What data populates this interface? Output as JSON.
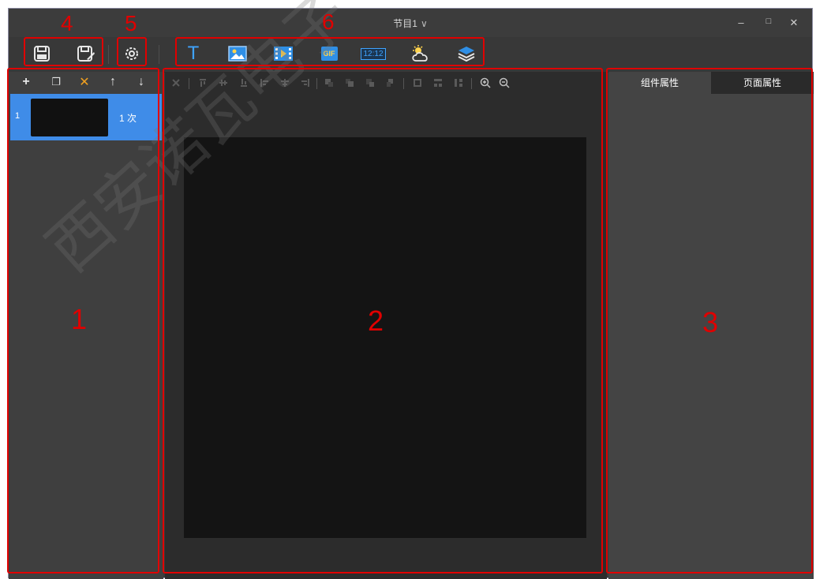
{
  "window": {
    "title": "节目1",
    "title_chevron": "∨",
    "controls": {
      "minimize": "–",
      "maximize": "□",
      "close": "✕"
    }
  },
  "toolbar": {
    "file_buttons": [
      {
        "icon": "save-icon"
      },
      {
        "icon": "save-as-icon"
      }
    ],
    "settings_button": {
      "icon": "gear-icon"
    },
    "insert_buttons": [
      {
        "icon": "text-icon",
        "glyph": "T"
      },
      {
        "icon": "image-icon"
      },
      {
        "icon": "video-icon"
      },
      {
        "icon": "gif-icon",
        "glyph": "GIF"
      },
      {
        "icon": "clock-icon",
        "glyph": "12:12"
      },
      {
        "icon": "weather-icon"
      },
      {
        "icon": "layers-icon"
      }
    ]
  },
  "page_list": {
    "tools": [
      {
        "icon": "add-icon",
        "glyph": "+"
      },
      {
        "icon": "copy-icon",
        "glyph": "❐"
      },
      {
        "icon": "delete-icon",
        "glyph": "✕"
      },
      {
        "icon": "move-up-icon",
        "glyph": "↑"
      },
      {
        "icon": "move-down-icon",
        "glyph": "↓"
      }
    ],
    "items": [
      {
        "index": "1",
        "count": "1 次"
      }
    ]
  },
  "canvas_tools": {
    "icons": [
      "close-icon",
      "align-top-icon",
      "align-vcenter-icon",
      "align-bottom-icon",
      "align-left-icon",
      "align-hcenter-icon",
      "align-right-icon",
      "bring-front-icon",
      "bring-forward-icon",
      "send-backward-icon",
      "send-back-icon",
      "fit-icon",
      "distribute-h-icon",
      "distribute-v-icon",
      "zoom-in-icon",
      "zoom-out-icon"
    ]
  },
  "right_panel": {
    "tabs": [
      {
        "label": "组件属性",
        "active": true
      },
      {
        "label": "页面属性",
        "active": false
      }
    ]
  },
  "annotations": {
    "labels": [
      "1",
      "2",
      "3",
      "4",
      "5",
      "6"
    ],
    "color": "#e00000"
  },
  "watermark": "西安诺瓦电子"
}
